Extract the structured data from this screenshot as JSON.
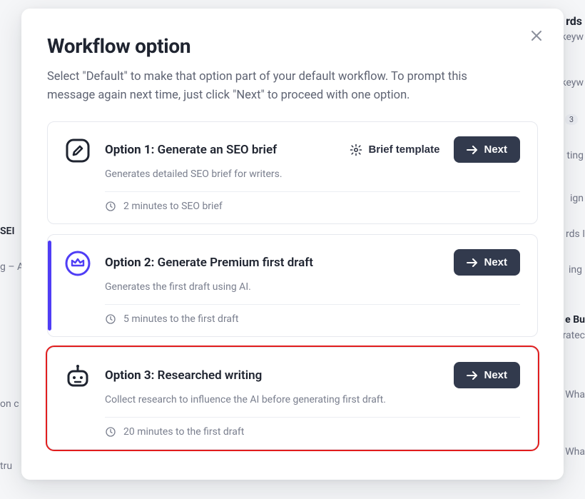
{
  "modal": {
    "title": "Workflow option",
    "description": "Select \"Default\" to make that option part of your default workflow. To prompt this message again next time, just click \"Next\" to proceed with one option.",
    "brief_template_label": "Brief template",
    "next_label": "Next",
    "options": [
      {
        "label": "Option 1:",
        "name": "Generate an SEO brief",
        "subtitle": "Generates detailed SEO brief for writers.",
        "eta": "2 minutes to SEO brief"
      },
      {
        "label": "Option 2:",
        "name": "Generate Premium first draft",
        "subtitle": "Generates the first draft using AI.",
        "eta": "5 minutes to the first draft"
      },
      {
        "label": "Option 3:",
        "name": "Researched writing",
        "subtitle": "Collect research to influence the AI before generating first draft.",
        "eta": "20 minutes to the first draft"
      }
    ]
  },
  "background": {
    "items": [
      "rds",
      "keyw",
      "keyw",
      "3",
      "ting",
      "ign",
      "rds I",
      "ing",
      "e Bu",
      "ratec",
      "Wha",
      "Wha",
      "SEI",
      "g – A",
      "on c",
      "tru"
    ]
  }
}
